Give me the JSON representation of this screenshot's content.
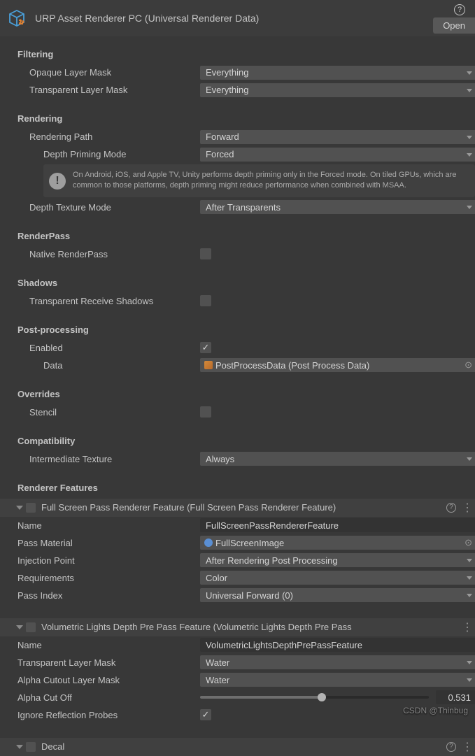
{
  "header": {
    "title": "URP Asset Renderer PC (Universal Renderer Data)",
    "open": "Open"
  },
  "filtering": {
    "header": "Filtering",
    "opaque_label": "Opaque Layer Mask",
    "opaque_value": "Everything",
    "transparent_label": "Transparent Layer Mask",
    "transparent_value": "Everything"
  },
  "rendering": {
    "header": "Rendering",
    "path_label": "Rendering Path",
    "path_value": "Forward",
    "priming_label": "Depth Priming Mode",
    "priming_value": "Forced",
    "info": "On Android, iOS, and Apple TV, Unity performs depth priming only in the Forced mode. On tiled GPUs, which are common to those platforms, depth priming might reduce performance when combined with MSAA.",
    "depthtex_label": "Depth Texture Mode",
    "depthtex_value": "After Transparents"
  },
  "renderpass": {
    "header": "RenderPass",
    "native_label": "Native RenderPass"
  },
  "shadows": {
    "header": "Shadows",
    "trs_label": "Transparent Receive Shadows"
  },
  "postproc": {
    "header": "Post-processing",
    "enabled_label": "Enabled",
    "data_label": "Data",
    "data_value": "PostProcessData (Post Process Data)"
  },
  "overrides": {
    "header": "Overrides",
    "stencil_label": "Stencil"
  },
  "compat": {
    "header": "Compatibility",
    "it_label": "Intermediate Texture",
    "it_value": "Always"
  },
  "features": {
    "header": "Renderer Features",
    "f1": {
      "title": "Full Screen Pass Renderer Feature (Full Screen Pass Renderer Feature)",
      "name_label": "Name",
      "name_value": "FullScreenPassRendererFeature",
      "mat_label": "Pass Material",
      "mat_value": "FullScreenImage",
      "inj_label": "Injection Point",
      "inj_value": "After Rendering Post Processing",
      "req_label": "Requirements",
      "req_value": "Color",
      "pi_label": "Pass Index",
      "pi_value": "Universal Forward (0)"
    },
    "f2": {
      "title": "Volumetric Lights Depth Pre Pass Feature (Volumetric Lights Depth Pre Pass",
      "name_label": "Name",
      "name_value": "VolumetricLightsDepthPrePassFeature",
      "tlm_label": "Transparent Layer Mask",
      "tlm_value": "Water",
      "aclm_label": "Alpha Cutout Layer Mask",
      "aclm_value": "Water",
      "aco_label": "Alpha Cut Off",
      "aco_value": "0.531",
      "aco_pct": 53.1,
      "irp_label": "Ignore Reflection Probes"
    },
    "f3": {
      "title": "Decal"
    }
  },
  "watermark": "CSDN @Thinbug"
}
